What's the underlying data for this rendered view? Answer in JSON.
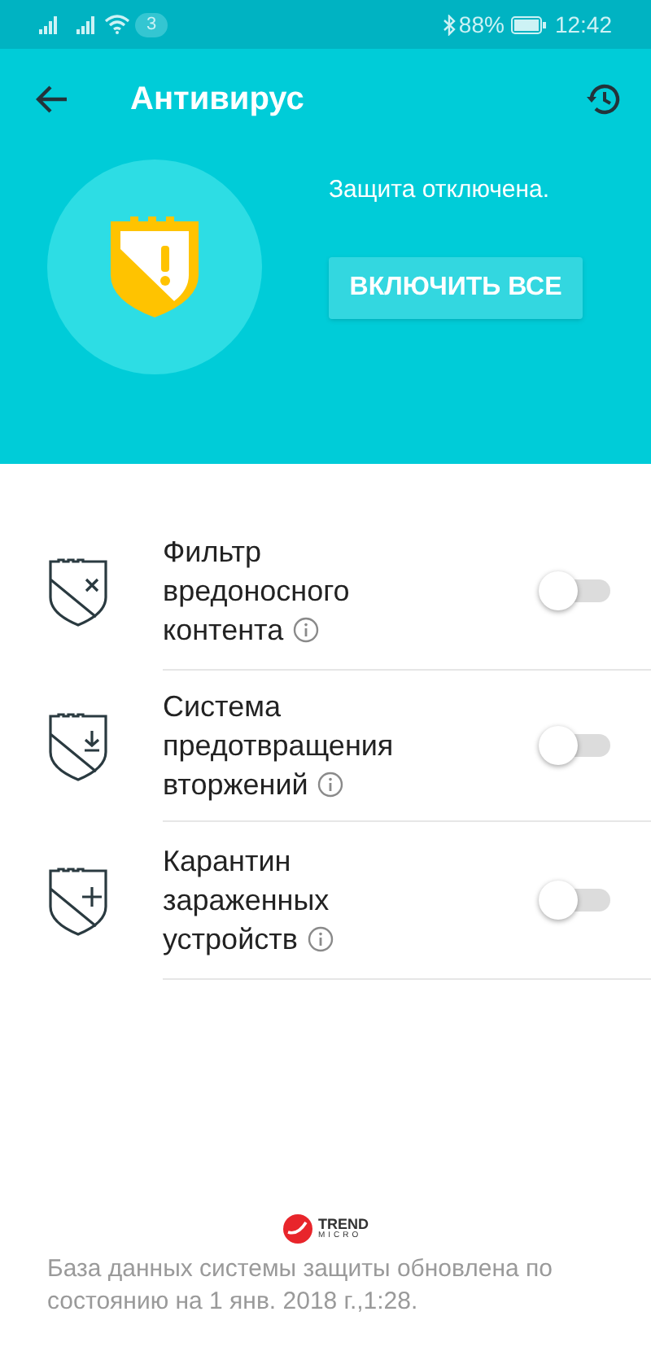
{
  "status_bar": {
    "notification_count": "3",
    "battery": "88%",
    "time": "12:42"
  },
  "header": {
    "title": "Антивирус"
  },
  "summary": {
    "status": "Защита отключена.",
    "button": "ВКЛЮЧИТЬ ВСЕ"
  },
  "features": [
    {
      "label": "Фильтр вредоносного контента",
      "on": false
    },
    {
      "label": "Система предотвращения вторжений",
      "on": false
    },
    {
      "label": "Карантин зараженных устройств",
      "on": false
    }
  ],
  "footer": {
    "logo": [
      "TREND",
      "MICRO"
    ],
    "note": "База данных системы защиты обновлена по состоянию на 1 янв. 2018 г.,1:28."
  }
}
